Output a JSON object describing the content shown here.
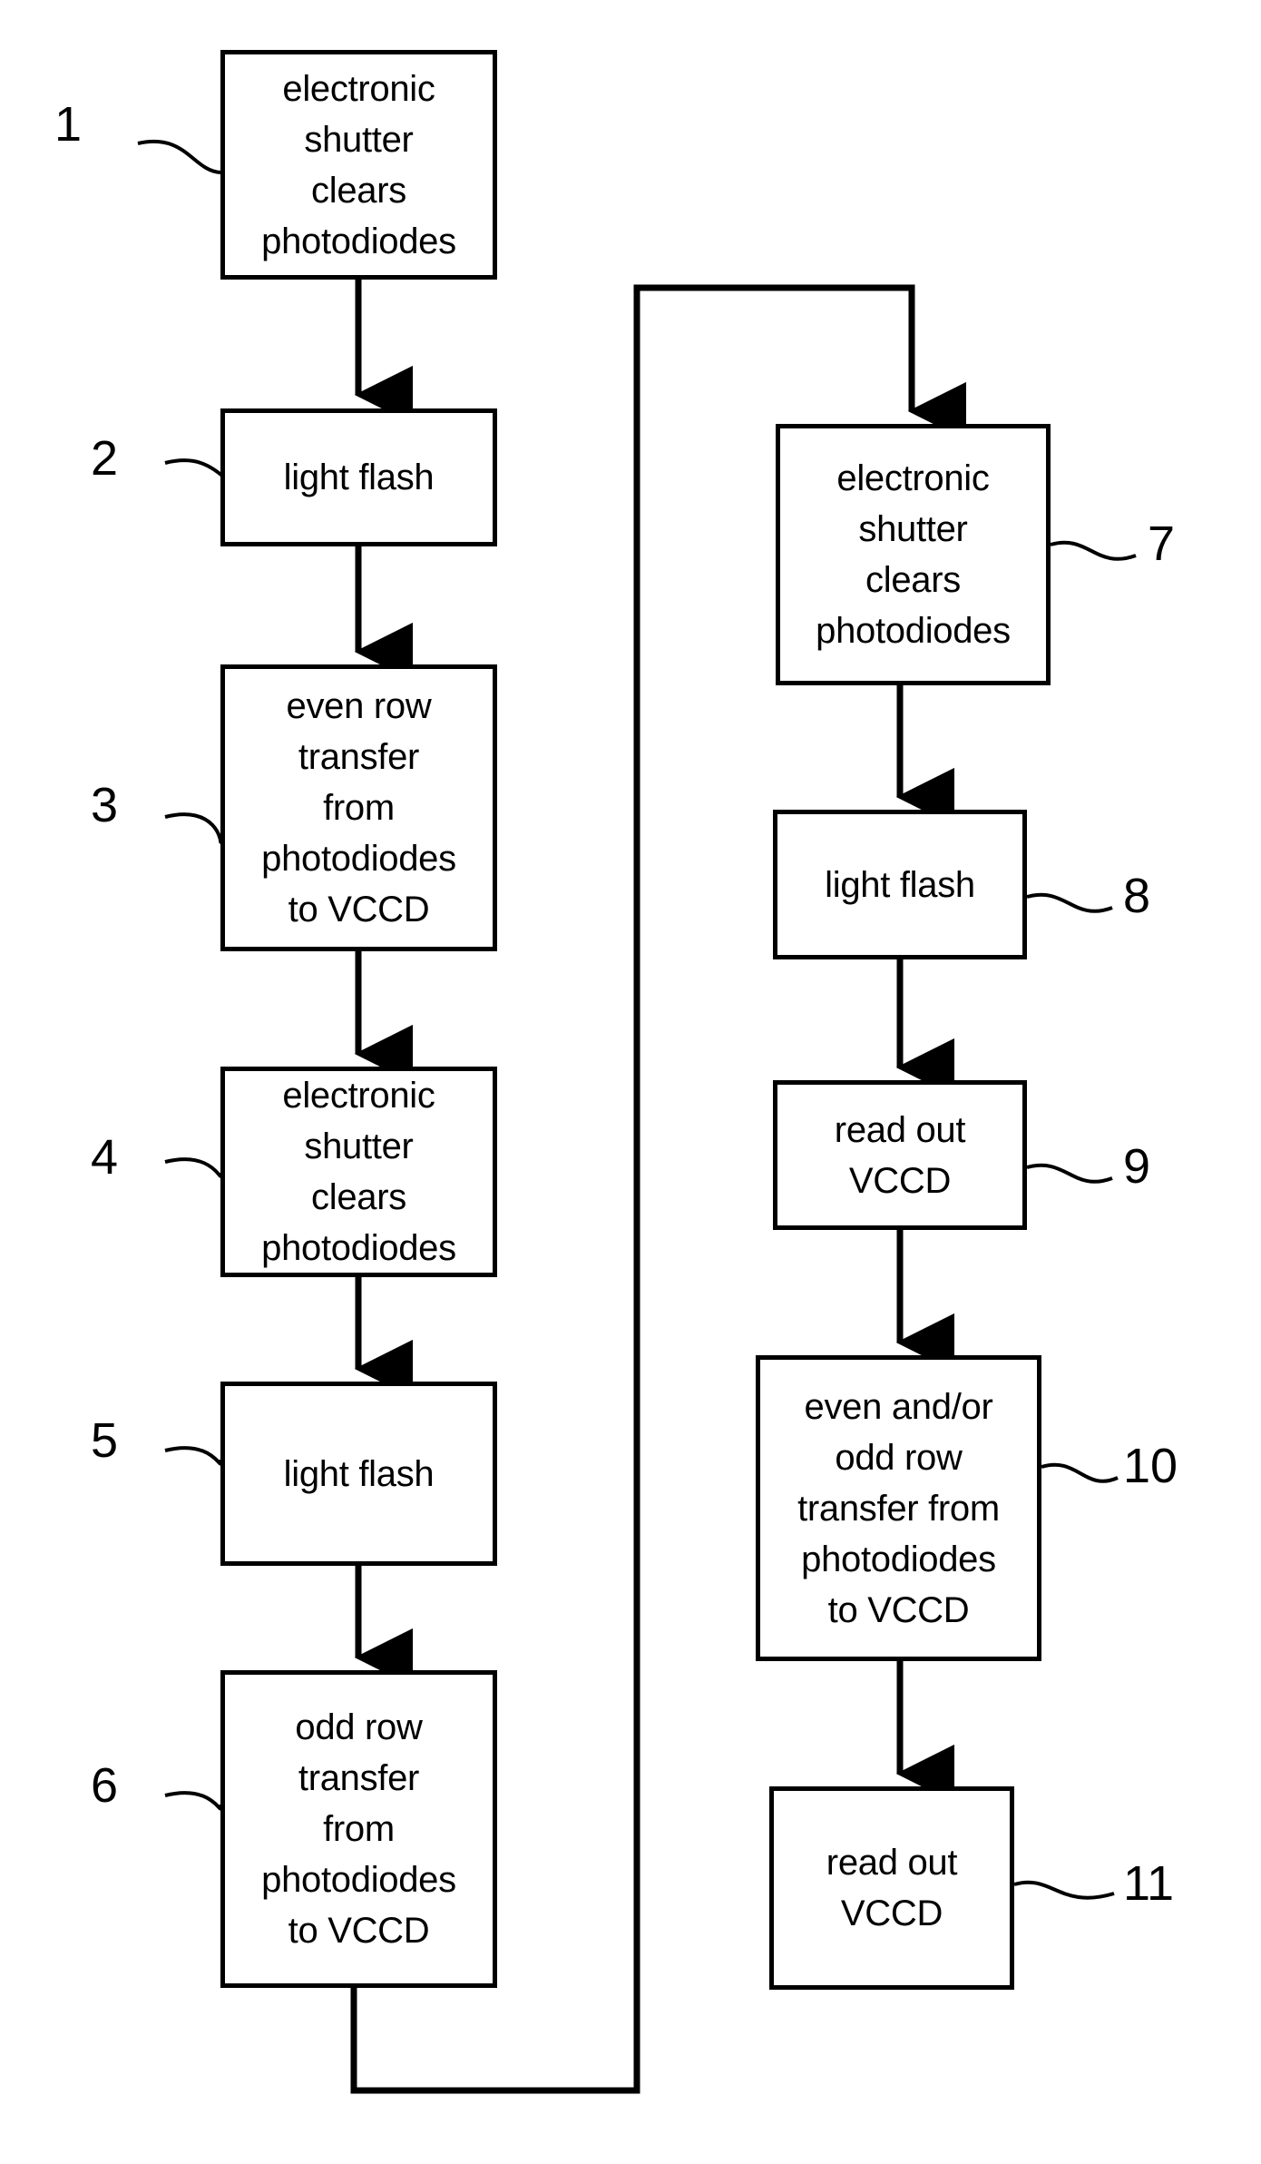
{
  "diagram": {
    "type": "flowchart",
    "title": "CCD electronic shutter / flash exposure sequence flowchart",
    "line_color": "#000000",
    "background_color": "#ffffff",
    "boxes": [
      {
        "ref": "1",
        "text": "electronic\nshutter\nclears\nphotodiodes"
      },
      {
        "ref": "2",
        "text": "light flash"
      },
      {
        "ref": "3",
        "text": "even row\ntransfer\nfrom\nphotodiodes\nto VCCD"
      },
      {
        "ref": "4",
        "text": "electronic\nshutter\nclears\nphotodiodes"
      },
      {
        "ref": "5",
        "text": "light flash"
      },
      {
        "ref": "6",
        "text": "odd row\ntransfer\nfrom\nphotodiodes\nto VCCD"
      },
      {
        "ref": "7",
        "text": "electronic\nshutter\nclears\nphotodiodes"
      },
      {
        "ref": "8",
        "text": "light flash"
      },
      {
        "ref": "9",
        "text": "read out\nVCCD"
      },
      {
        "ref": "10",
        "text": "even and/or\nodd row\ntransfer from\nphotodiodes\nto VCCD"
      },
      {
        "ref": "11",
        "text": "read out\nVCCD"
      }
    ],
    "reference_numerals": [
      "1",
      "2",
      "3",
      "4",
      "5",
      "6",
      "7",
      "8",
      "9",
      "10",
      "11"
    ],
    "flow": [
      {
        "from": "1",
        "to": "2"
      },
      {
        "from": "2",
        "to": "3"
      },
      {
        "from": "3",
        "to": "4"
      },
      {
        "from": "4",
        "to": "5"
      },
      {
        "from": "5",
        "to": "6"
      },
      {
        "from": "6",
        "to": "7",
        "style": "routed-feedback"
      },
      {
        "from": "7",
        "to": "8"
      },
      {
        "from": "8",
        "to": "9"
      },
      {
        "from": "9",
        "to": "10"
      },
      {
        "from": "10",
        "to": "11"
      }
    ]
  }
}
